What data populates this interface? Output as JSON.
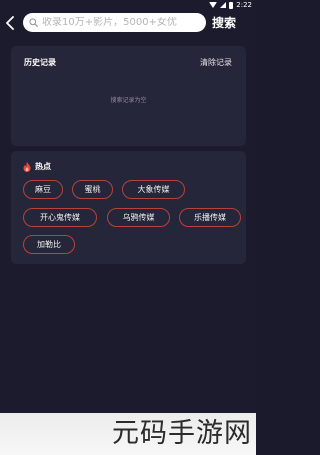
{
  "status_bar": {
    "time": "2:22",
    "icons": [
      "wifi-icon",
      "signal-icon",
      "battery-icon"
    ]
  },
  "header": {
    "search_placeholder": "收录10万+影片，5000+女优",
    "search_button": "搜索"
  },
  "history": {
    "title": "历史记录",
    "clear_label": "清除记录",
    "empty_text": "搜索记录为空"
  },
  "hot": {
    "title": "热点",
    "tags": [
      "麻豆",
      "蜜桃",
      "大象传媒",
      "开心鬼传媒",
      "乌鸦传媒",
      "乐播传媒",
      "加勒比"
    ]
  },
  "watermark": {
    "text": "元码手游网"
  },
  "colors": {
    "background": "#1b1b2d",
    "card": "#26263a",
    "chip_border": "#b9413b",
    "fire_icon": "#e8473c"
  }
}
